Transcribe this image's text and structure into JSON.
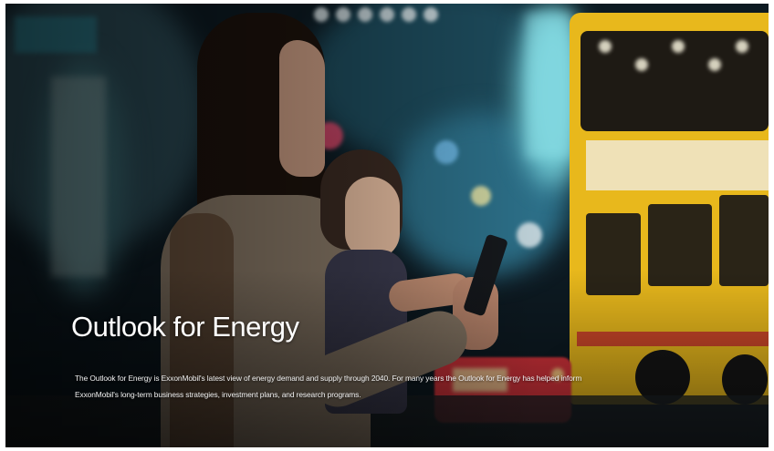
{
  "hero": {
    "title": "Outlook for Energy",
    "description": "The Outlook for Energy is ExxonMobil's latest view of energy demand and supply through 2040. For many years the Outlook for Energy has helped inform ExxonMobil's long-term business strategies, investment plans, and research programs.",
    "background_image": "photo-woman-holding-child-with-smartphone-city-night",
    "colors": {
      "text": "#ffffff",
      "bus_yellow": "#e8b81c",
      "neon_teal": "#3fb7c4",
      "taxi_red": "#d8343c"
    }
  }
}
